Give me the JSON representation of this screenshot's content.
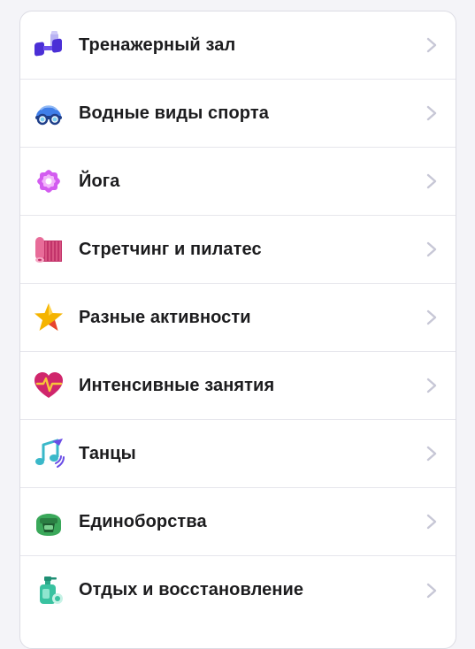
{
  "list": {
    "items": [
      {
        "label": "Тренажерный зал",
        "icon": "dumbbell-icon",
        "color": "#5a3de6"
      },
      {
        "label": "Водные виды спорта",
        "icon": "swim-cap-icon",
        "color": "#3f7ee8"
      },
      {
        "label": "Йога",
        "icon": "lotus-icon",
        "color": "#d35cf0"
      },
      {
        "label": "Стретчинг и пилатес",
        "icon": "yoga-mat-icon",
        "color": "#d6457a"
      },
      {
        "label": "Разные активности",
        "icon": "star-icon",
        "color": "#f5b400"
      },
      {
        "label": "Интенсивные занятия",
        "icon": "heart-pulse-icon",
        "color": "#e0307a"
      },
      {
        "label": "Танцы",
        "icon": "music-note-icon",
        "color": "#3ab8c9"
      },
      {
        "label": "Единоборства",
        "icon": "boxing-helmet-icon",
        "color": "#3aa85a"
      },
      {
        "label": "Отдых и восстановление",
        "icon": "spray-bottle-icon",
        "color": "#39c2a0"
      }
    ]
  },
  "colors": {
    "chevron": "#c7c7d6",
    "divider": "#e6e6ec",
    "text": "#1c1c1e"
  }
}
